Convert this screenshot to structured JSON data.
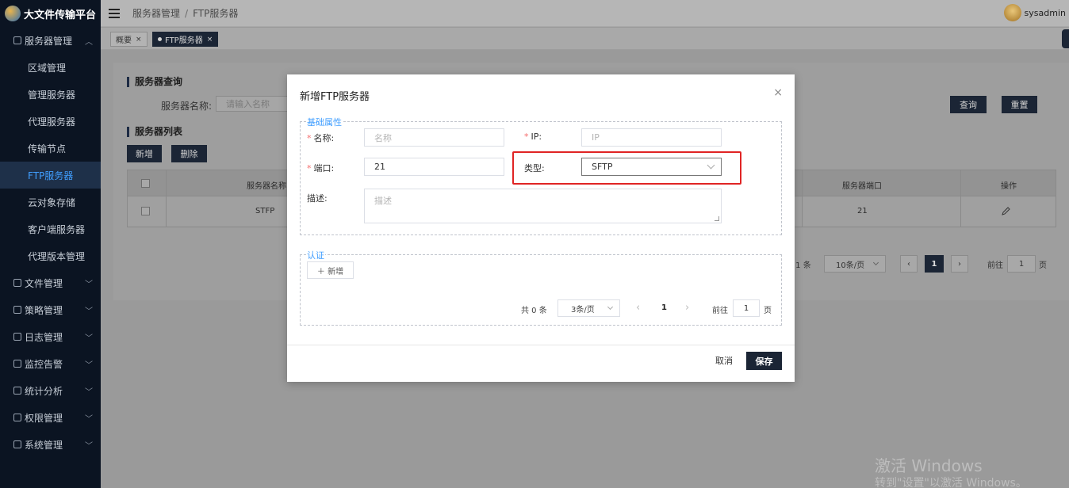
{
  "app": {
    "title": "大文件传输平台",
    "user": "sysadmin"
  },
  "breadcrumb": {
    "parent": "服务器管理",
    "sep": "/",
    "current": "FTP服务器"
  },
  "tags": [
    {
      "label": "概要",
      "close": "×"
    },
    {
      "label": "FTP服务器",
      "close": "×"
    }
  ],
  "sidebar": {
    "server_group": "服务器管理",
    "server_items": [
      "区域管理",
      "管理服务器",
      "代理服务器",
      "传输节点",
      "FTP服务器",
      "云对象存储",
      "客户端服务器",
      "代理版本管理"
    ],
    "groups": [
      "文件管理",
      "策略管理",
      "日志管理",
      "监控告警",
      "统计分析",
      "权限管理",
      "系统管理"
    ]
  },
  "page": {
    "query_title": "服务器查询",
    "name_label": "服务器名称:",
    "name_placeholder": "请输入名称",
    "query_btn": "查询",
    "reset_btn": "重置",
    "list_title": "服务器列表",
    "add_btn": "新增",
    "delete_btn": "删除",
    "table": {
      "headers": {
        "name": "服务器名称",
        "port": "服务器端口",
        "ops": "操作"
      },
      "rows": [
        {
          "name": "STFP",
          "port": "21"
        }
      ]
    },
    "pagination": {
      "total_text": "共 1 条",
      "page_size": "10条/页",
      "current": "1",
      "goto_label": "前往",
      "goto_value": "1",
      "page_unit": "页"
    }
  },
  "modal": {
    "title": "新增FTP服务器",
    "close": "×",
    "basic_legend": "基础属性",
    "required_mark": "*",
    "name_label": "名称:",
    "name_placeholder": "名称",
    "ip_label": "IP:",
    "ip_placeholder": "IP",
    "port_label": "端口:",
    "port_value": "21",
    "type_label": "类型:",
    "type_value": "SFTP",
    "desc_label": "描述:",
    "desc_placeholder": "描述",
    "auth_legend": "认证",
    "auth_add_btn": "＋ 新增",
    "auth_pagination": {
      "total": "共 0 条",
      "page_size": "3条/页",
      "prev": "‹",
      "current": "1",
      "next": "›",
      "goto_label": "前往",
      "goto_value": "1",
      "page_unit": "页"
    },
    "cancel_btn": "取消",
    "save_btn": "保存"
  },
  "watermark": {
    "line1": "激活 Windows",
    "line2": "转到\"设置\"以激活 Windows。"
  }
}
